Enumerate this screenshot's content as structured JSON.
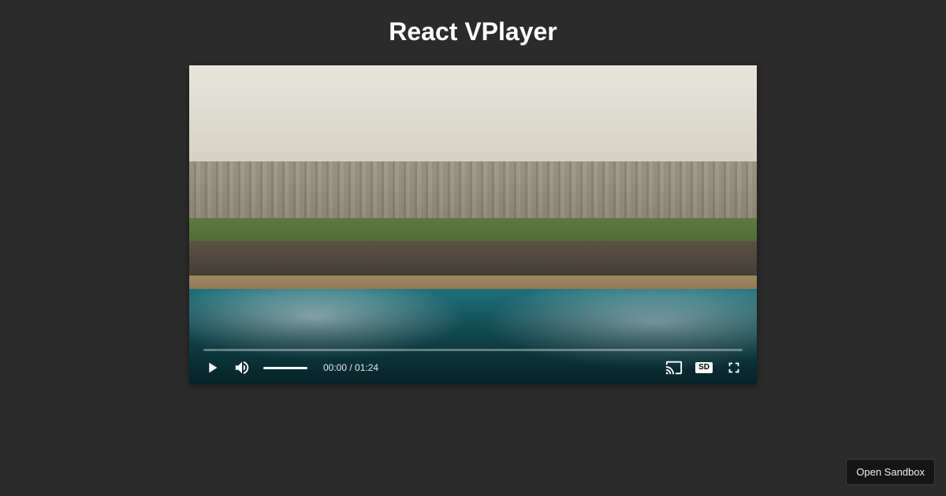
{
  "header": {
    "title": "React VPlayer"
  },
  "player": {
    "current_time": "00:00",
    "duration": "01:24",
    "time_separator": " / ",
    "quality_label": "SD",
    "progress_percent": 0,
    "volume_percent": 100
  },
  "footer": {
    "open_sandbox_label": "Open Sandbox"
  }
}
